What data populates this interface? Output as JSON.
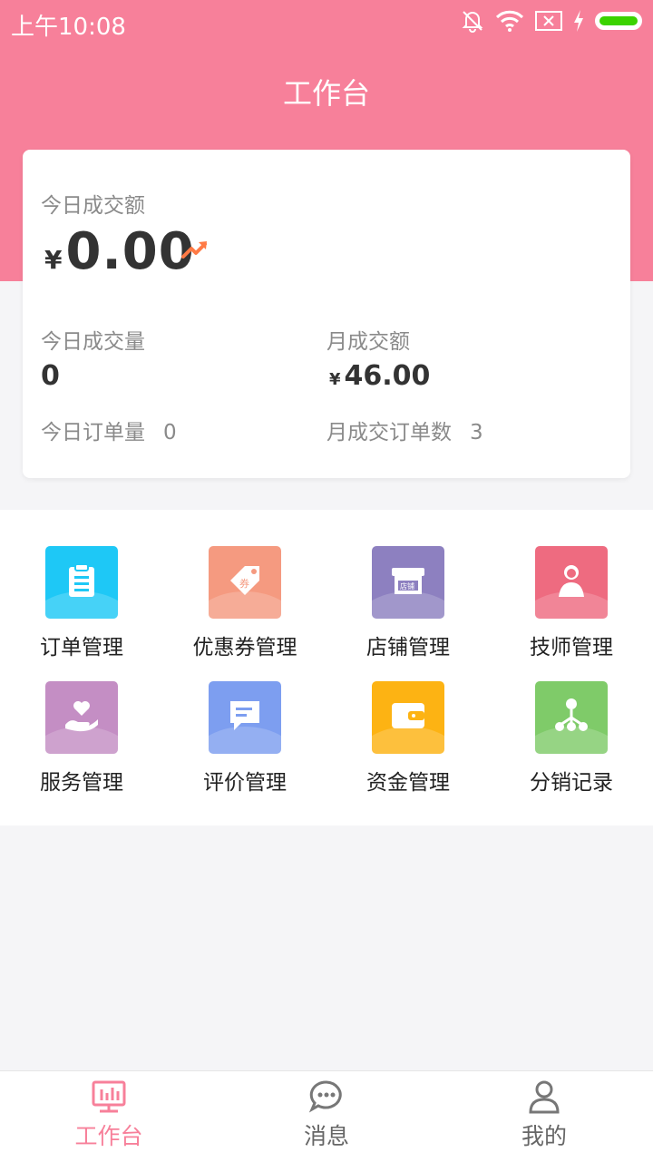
{
  "status": {
    "time": "上午10:08"
  },
  "header": {
    "title": "工作台"
  },
  "summary": {
    "today_amount_label": "今日成交额",
    "currency": "¥",
    "today_amount": "0.00",
    "today_volume_label": "今日成交量",
    "today_volume": "0",
    "month_amount_label": "月成交额",
    "month_amount": "46.00",
    "today_orders_label": "今日订单量",
    "today_orders": "0",
    "month_orders_label": "月成交订单数",
    "month_orders": "3"
  },
  "menu": [
    {
      "label": "订单管理",
      "icon": "clipboard-icon",
      "color": "#1ec8f6"
    },
    {
      "label": "优惠券管理",
      "icon": "coupon-tag-icon",
      "color": "#f59a80"
    },
    {
      "label": "店铺管理",
      "icon": "store-icon",
      "color": "#8d80c0"
    },
    {
      "label": "技师管理",
      "icon": "technician-icon",
      "color": "#ee6b80"
    },
    {
      "label": "服务管理",
      "icon": "heart-hand-icon",
      "color": "#c48ec4"
    },
    {
      "label": "评价管理",
      "icon": "comment-icon",
      "color": "#7d9ef0"
    },
    {
      "label": "资金管理",
      "icon": "wallet-icon",
      "color": "#fdb313"
    },
    {
      "label": "分销记录",
      "icon": "distribution-tree-icon",
      "color": "#7fcb69"
    }
  ],
  "tabs": [
    {
      "label": "工作台",
      "icon": "dashboard-chart-icon",
      "active": true
    },
    {
      "label": "消息",
      "icon": "message-bubble-icon",
      "active": false
    },
    {
      "label": "我的",
      "icon": "user-profile-icon",
      "active": false
    }
  ],
  "colors": {
    "accent": "#f7809a",
    "trend": "#ff7a45"
  }
}
